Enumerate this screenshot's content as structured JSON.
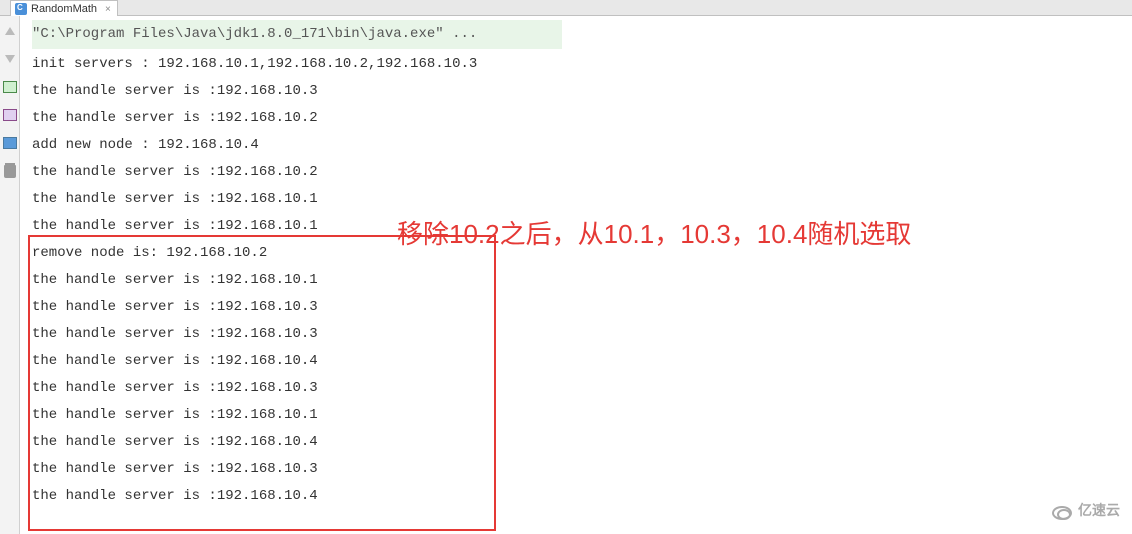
{
  "tab": {
    "title": "RandomMath",
    "close": "×"
  },
  "console": {
    "cmd": "\"C:\\Program Files\\Java\\jdk1.8.0_171\\bin\\java.exe\" ...",
    "lines": [
      "init servers : 192.168.10.1,192.168.10.2,192.168.10.3",
      "the handle server is :192.168.10.3",
      "the handle server is :192.168.10.2",
      "add new node : 192.168.10.4",
      "the handle server is :192.168.10.2",
      "the handle server is :192.168.10.1",
      "the handle server is :192.168.10.1",
      "remove node is: 192.168.10.2",
      "the handle server is :192.168.10.1",
      "the handle server is :192.168.10.3",
      "the handle server is :192.168.10.3",
      "the handle server is :192.168.10.4",
      "the handle server is :192.168.10.3",
      "the handle server is :192.168.10.1",
      "the handle server is :192.168.10.4",
      "the handle server is :192.168.10.3",
      "the handle server is :192.168.10.4"
    ]
  },
  "annotation": {
    "text": "移除10.2之后，从10.1，10.3，10.4随机选取"
  },
  "watermark": {
    "text": "亿速云"
  },
  "gutter_icons": [
    "arrow-up-icon",
    "arrow-down-icon",
    "layout-icon",
    "export-icon",
    "print-icon",
    "trash-icon"
  ]
}
